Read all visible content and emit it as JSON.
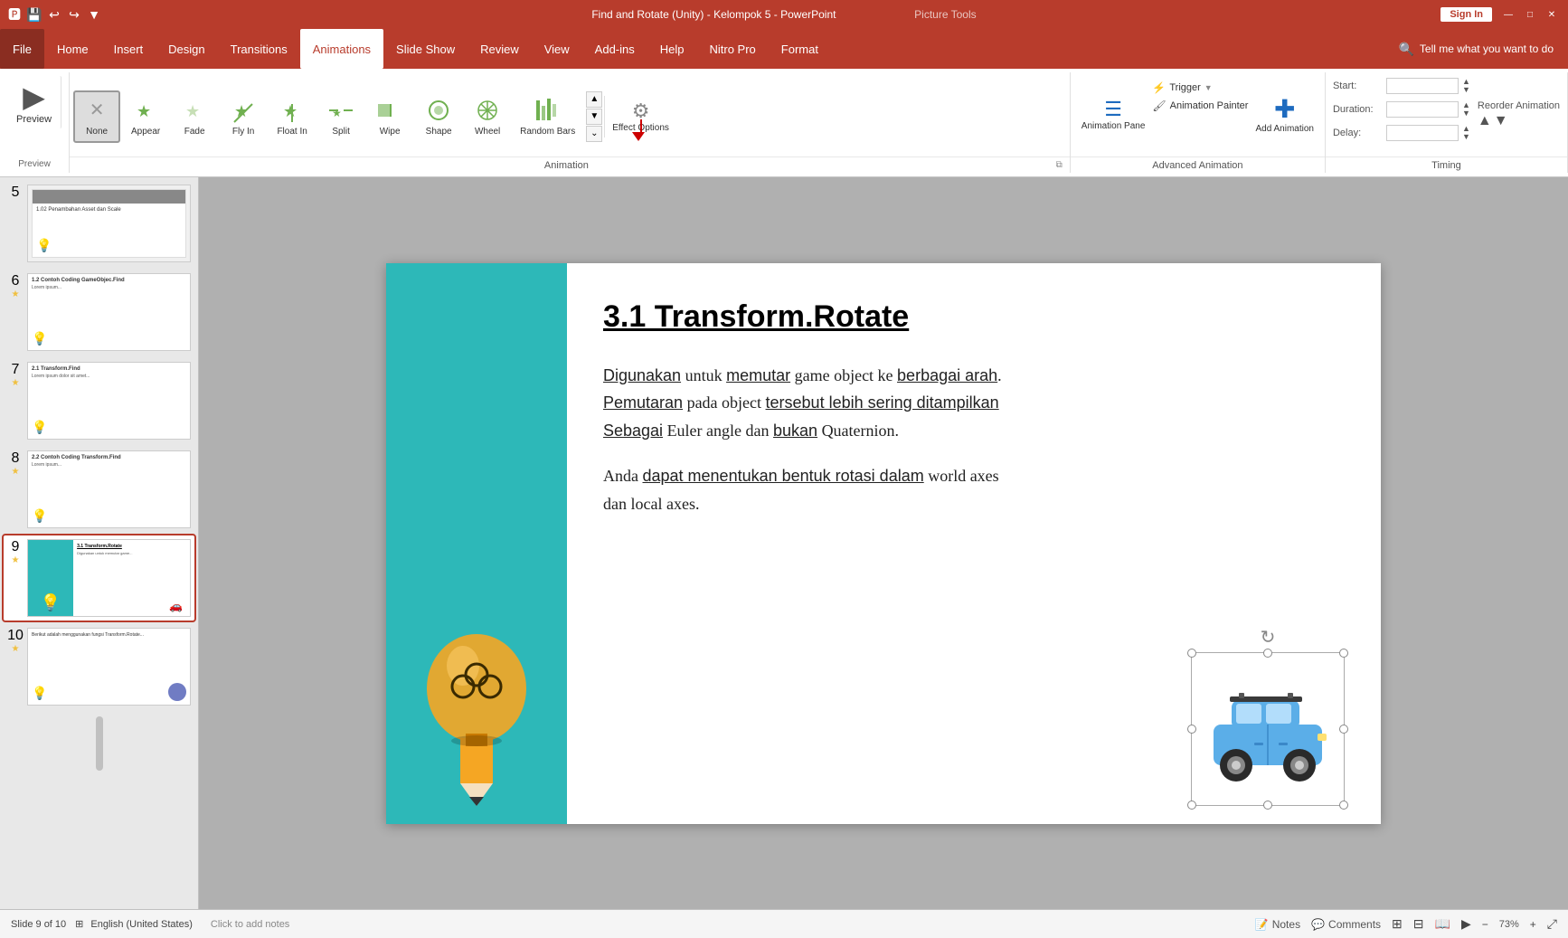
{
  "titlebar": {
    "title": "Find and Rotate (Unity) - Kelompok 5 - PowerPoint",
    "picture_tools": "Picture Tools",
    "sign_in": "Sign In"
  },
  "menubar": {
    "items": [
      "File",
      "Home",
      "Insert",
      "Design",
      "Transitions",
      "Animations",
      "Slide Show",
      "Review",
      "View",
      "Add-ins",
      "Help",
      "Nitro Pro",
      "Format"
    ],
    "active": "Animations",
    "search_placeholder": "Tell me what you want to do"
  },
  "ribbon": {
    "preview_label": "Preview",
    "preview_btn": "Preview",
    "animation_group_label": "Animation",
    "none_label": "None",
    "appear_label": "Appear",
    "fade_label": "Fade",
    "fly_in_label": "Fly In",
    "float_in_label": "Float In",
    "split_label": "Split",
    "wipe_label": "Wipe",
    "shape_label": "Shape",
    "wheel_label": "Wheel",
    "random_bars_label": "Random Bars",
    "effect_options_label": "Effect Options",
    "advanced_animation_label": "Advanced Animation",
    "animation_pane_label": "Animation Pane",
    "trigger_label": "Trigger",
    "animation_painter_label": "Animation Painter",
    "add_animation_label": "Add Animation",
    "timing_label": "Timing",
    "start_label": "Start:",
    "duration_label": "Duration:",
    "delay_label": "Delay:",
    "reorder_label": "Reorder Animation"
  },
  "slide_panel": {
    "slides": [
      {
        "num": "5",
        "has_star": false
      },
      {
        "num": "6",
        "has_star": true
      },
      {
        "num": "7",
        "has_star": true
      },
      {
        "num": "8",
        "has_star": true
      },
      {
        "num": "9",
        "has_star": true,
        "active": true
      },
      {
        "num": "10",
        "has_star": true
      }
    ]
  },
  "slide": {
    "title": "3.1 Transform.Rotate",
    "paragraph1_1": "Digunakan untuk memutar game object ke berbagai arah.",
    "paragraph1_2": "Pemutaran pada object tersebut lebih sering ditampilkan",
    "paragraph1_3": "Sebagai Euler angle dan bukan Quaternion.",
    "paragraph2": "Anda dapat menentukan bentuk rotasi dalam world axes dan local axes."
  },
  "status_bar": {
    "slide_info": "Slide 9 of 10",
    "language": "English (United States)",
    "notes_btn": "Notes",
    "comments_btn": "Comments",
    "click_to_add_notes": "Click to add notes"
  },
  "icons": {
    "save": "💾",
    "undo": "↩",
    "redo": "↪",
    "quick_access": "▼",
    "search": "🔍",
    "preview": "▶",
    "none": "✕",
    "animation_pane": "☰",
    "add_animation": "✚",
    "trigger": "▼",
    "animation_painter": "🖌",
    "effect_options": "▼",
    "scroll_up": "▲",
    "scroll_down": "▼",
    "scroll_more": "⌄",
    "notes_icon": "📝",
    "comments_icon": "💬",
    "slide_view": "⊞",
    "fit": "⤢",
    "zoom_out": "−",
    "zoom_in": "+"
  }
}
